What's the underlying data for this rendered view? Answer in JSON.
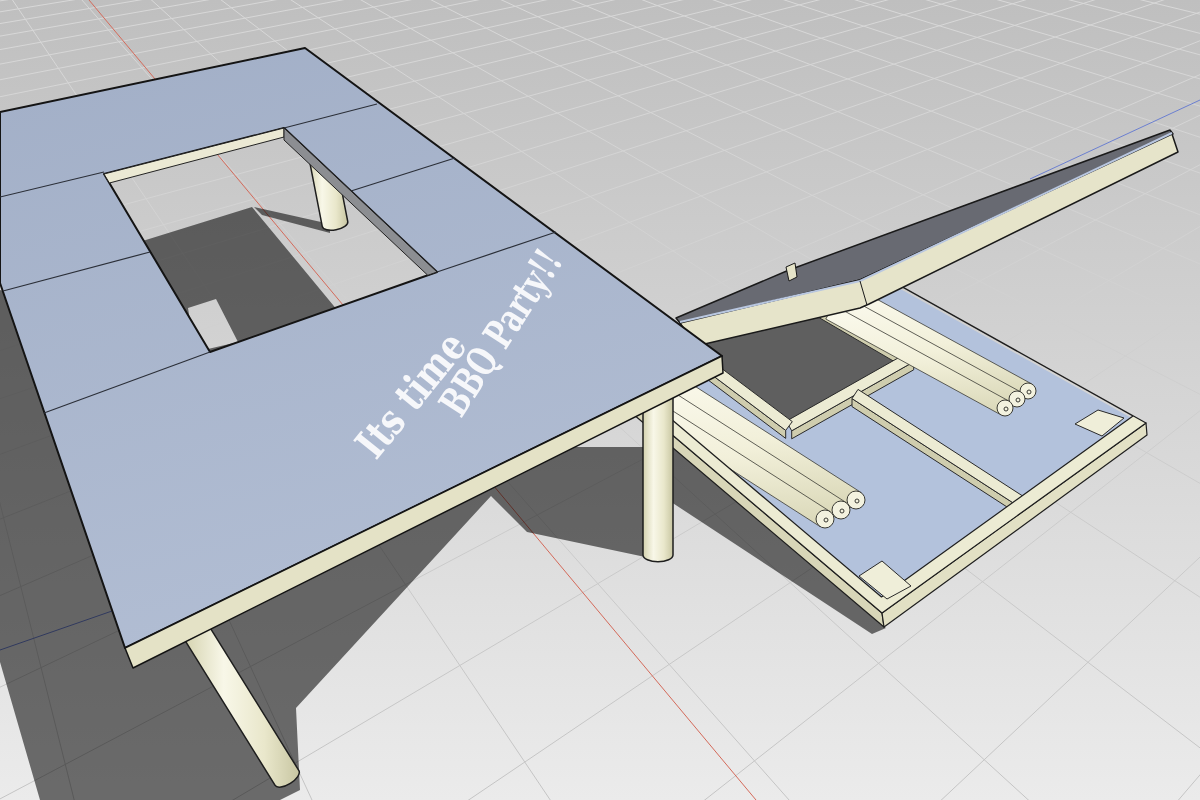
{
  "scene": {
    "table_lettering": [
      {
        "text": "Its time"
      },
      {
        "text": "BBQ Party!!"
      }
    ]
  }
}
